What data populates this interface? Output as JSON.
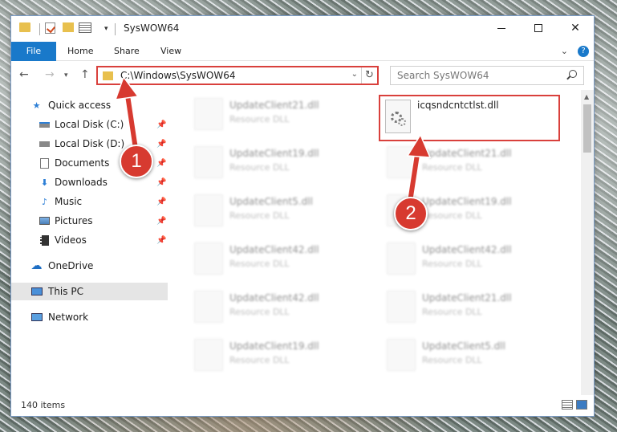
{
  "window": {
    "title": "SysWOW64"
  },
  "ribbon": {
    "tabs": [
      "File",
      "Home",
      "Share",
      "View"
    ]
  },
  "address": {
    "path": "C:\\Windows\\SysWOW64"
  },
  "search": {
    "placeholder": "Search SysWOW64"
  },
  "sidebar": {
    "items": [
      {
        "label": "Quick access",
        "icon": "star-icon"
      },
      {
        "label": "Local Disk (C:)",
        "icon": "drive-icon",
        "pinned": true
      },
      {
        "label": "Local Disk (D:)",
        "icon": "drive-icon",
        "pinned": true
      },
      {
        "label": "Documents",
        "icon": "documents-icon",
        "pinned": true
      },
      {
        "label": "Downloads",
        "icon": "download-icon",
        "pinned": true
      },
      {
        "label": "Music",
        "icon": "music-icon",
        "pinned": true
      },
      {
        "label": "Pictures",
        "icon": "pictures-icon",
        "pinned": true
      },
      {
        "label": "Videos",
        "icon": "videos-icon",
        "pinned": true
      },
      {
        "label": "OneDrive",
        "icon": "cloud-icon"
      },
      {
        "label": "This PC",
        "icon": "computer-icon",
        "selected": true
      },
      {
        "label": "Network",
        "icon": "network-icon"
      }
    ]
  },
  "files": {
    "selected": {
      "name": "icqsndcntctlst.dll"
    },
    "col1": [
      {
        "name": "UpdateClient21.dll",
        "type": "Resource DLL"
      },
      {
        "name": "UpdateClient19.dll",
        "type": "Resource DLL"
      },
      {
        "name": "UpdateClient5.dll",
        "type": "Resource DLL"
      },
      {
        "name": "UpdateClient42.dll",
        "type": "Resource DLL"
      },
      {
        "name": "UpdateClient42.dll",
        "type": "Resource DLL"
      },
      {
        "name": "UpdateClient19.dll",
        "type": "Resource DLL"
      }
    ],
    "col2": [
      {
        "name": "UpdateClient21.dll",
        "type": "Resource DLL"
      },
      {
        "name": "UpdateClient19.dll",
        "type": "Resource DLL"
      },
      {
        "name": "UpdateClient42.dll",
        "type": "Resource DLL"
      },
      {
        "name": "UpdateClient21.dll",
        "type": "Resource DLL"
      },
      {
        "name": "UpdateClient5.dll",
        "type": "Resource DLL"
      }
    ]
  },
  "status": {
    "count": "140 items"
  },
  "callouts": {
    "one": "1",
    "two": "2"
  },
  "colors": {
    "accent": "#1979ca",
    "highlight": "#d9403c"
  }
}
